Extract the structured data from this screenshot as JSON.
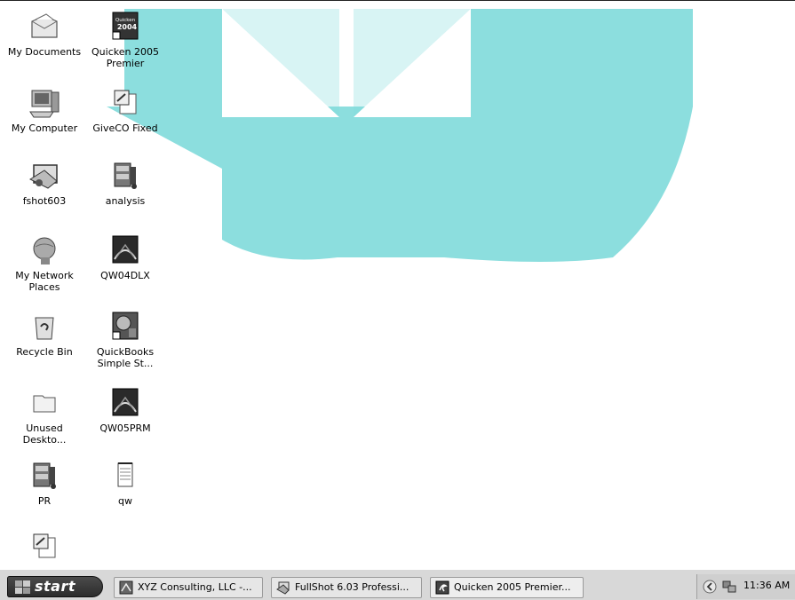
{
  "desktop": {
    "icons": [
      {
        "label": "My Documents",
        "icon": "my-documents-icon"
      },
      {
        "label": "Quicken 2005 Premier",
        "icon": "quicken-2004-shortcut-icon",
        "badge": "Quicken 2004"
      },
      {
        "label": "My Computer",
        "icon": "my-computer-icon"
      },
      {
        "label": "GiveCO Fixed",
        "icon": "document-key-icon"
      },
      {
        "label": "fshot603",
        "icon": "fullshot-icon"
      },
      {
        "label": "analysis",
        "icon": "archive-icon"
      },
      {
        "label": "My Network Places",
        "icon": "network-places-icon"
      },
      {
        "label": "QW04DLX",
        "icon": "quicken-pdf-icon"
      },
      {
        "label": "Recycle Bin",
        "icon": "recycle-bin-icon"
      },
      {
        "label": "QuickBooks Simple St...",
        "icon": "quickbooks-shortcut-icon"
      },
      {
        "label": "Unused Deskto...",
        "icon": "folder-icon"
      },
      {
        "label": "QW05PRM",
        "icon": "quicken-pdf-icon"
      },
      {
        "label": "PR",
        "icon": "archive-icon"
      },
      {
        "label": "qw",
        "icon": "notepad-icon"
      },
      {
        "label": "",
        "icon": "document-key-icon"
      }
    ]
  },
  "taskbar": {
    "start_label": "start",
    "tasks": [
      {
        "label": "XYZ Consulting, LLC -...",
        "icon": "quickbooks-icon"
      },
      {
        "label": "FullShot 6.03 Professi...",
        "icon": "fullshot-icon"
      },
      {
        "label": "Quicken 2005 Premier...",
        "icon": "quicken-icon"
      }
    ],
    "clock": "11:36 AM"
  }
}
